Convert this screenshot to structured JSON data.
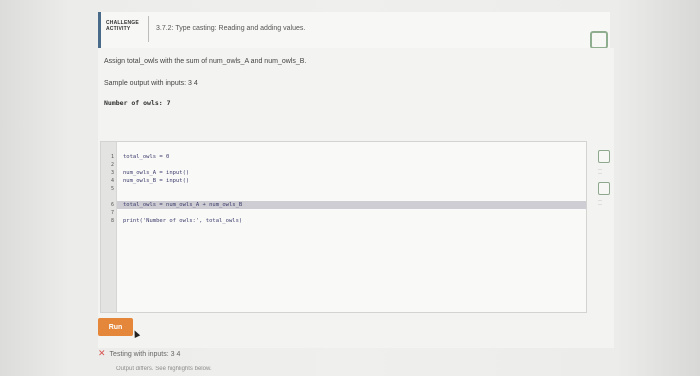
{
  "header": {
    "badge_line1": "CHALLENGE",
    "badge_line2": "ACTIVITY",
    "title": "3.7.2: Type casting: Reading and adding values."
  },
  "instructions": "Assign total_owls with the sum of num_owls_A and num_owls_B.",
  "sample": {
    "label": "Sample output with inputs: 3 4",
    "output": "Number of owls: 7"
  },
  "editor": {
    "lines": [
      {
        "num": "1",
        "code": "total_owls = 0"
      },
      {
        "num": "2",
        "code": ""
      },
      {
        "num": "3",
        "code": "num_owls_A = input()"
      },
      {
        "num": "4",
        "code": "num_owls_B = input()"
      },
      {
        "num": "5",
        "code": ""
      },
      {
        "num": "6",
        "code": "total_owls = num_owls_A + num_owls_B"
      },
      {
        "num": "7",
        "code": ""
      },
      {
        "num": "8",
        "code": "print('Number of owls:', total_owls)"
      }
    ]
  },
  "run_label": "Run",
  "result": {
    "text": "Testing with inputs: 3 4",
    "status": "fail"
  },
  "diff_text": "Output differs. See highlights below.",
  "colors": {
    "run": "#e4873a",
    "fail": "#d9534f",
    "check": "#8fae8f"
  }
}
